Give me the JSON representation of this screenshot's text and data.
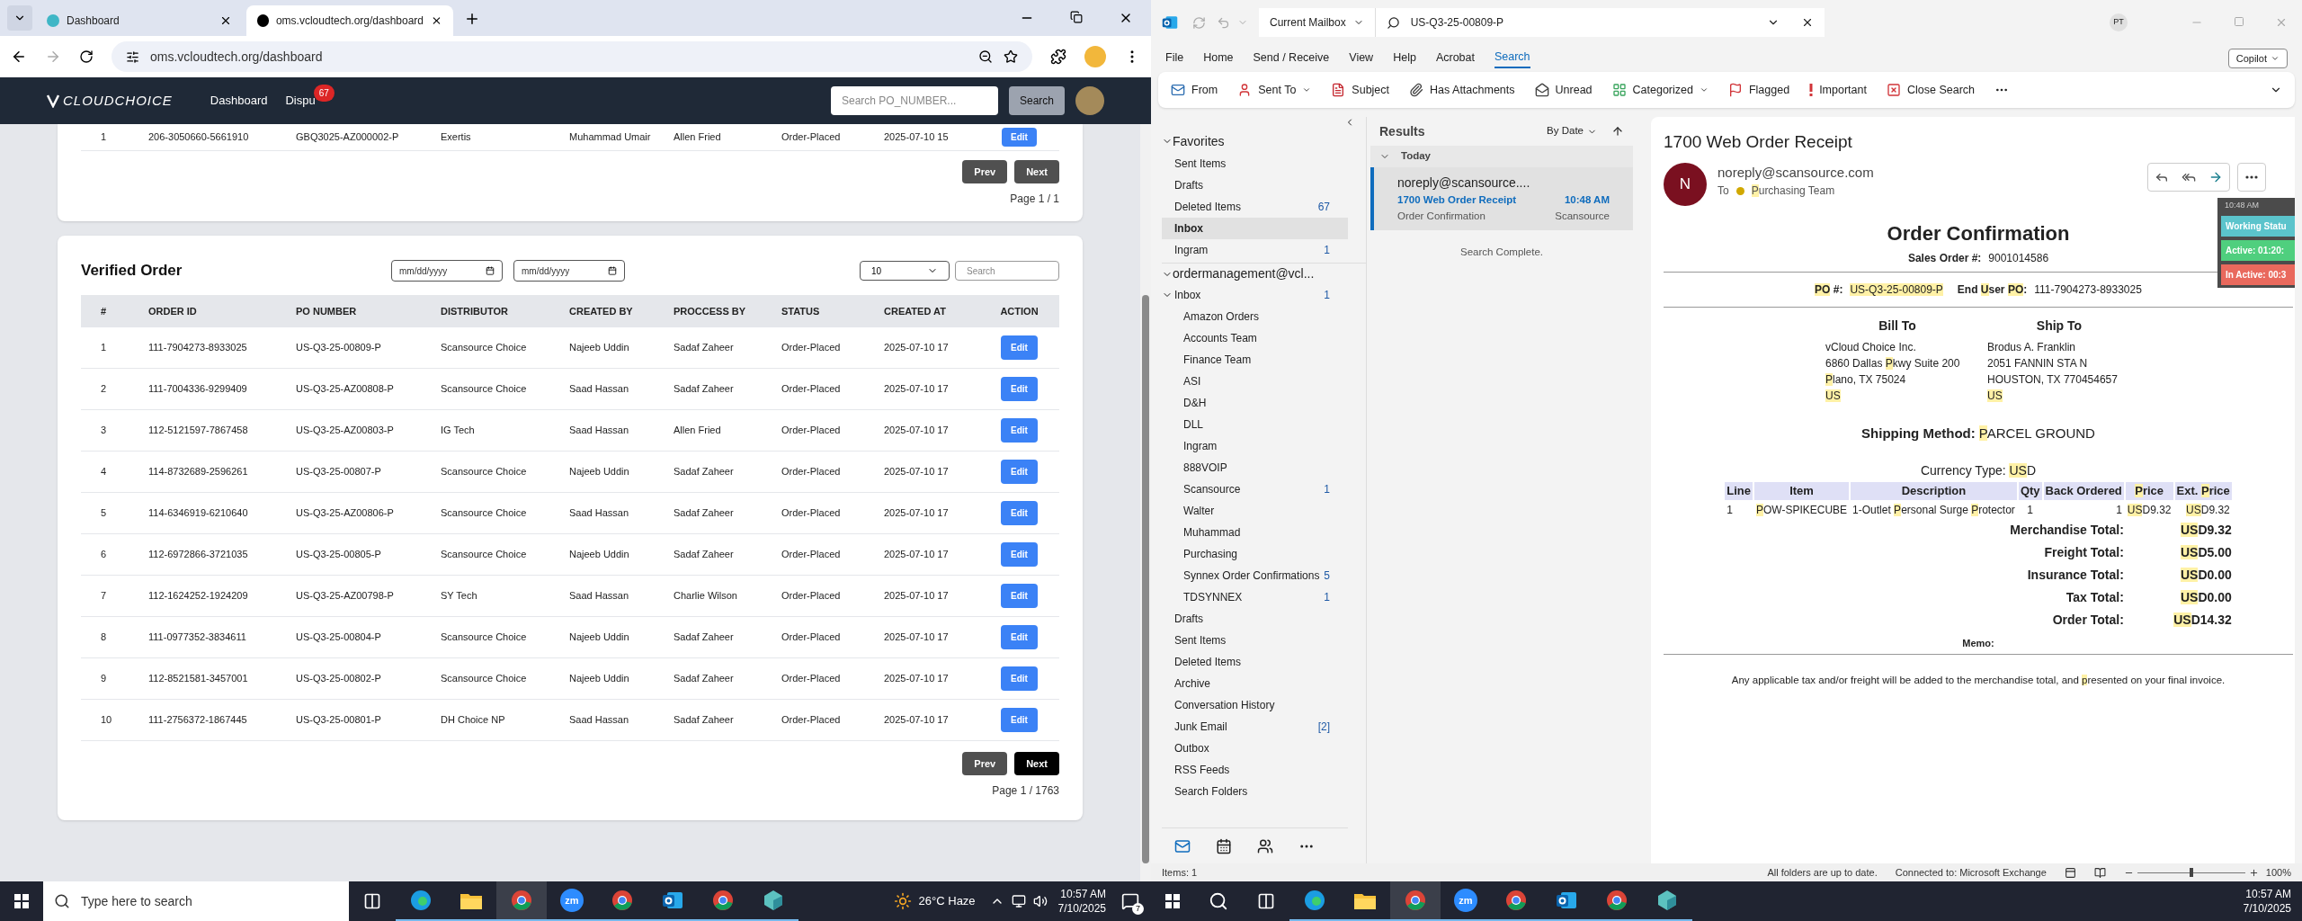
{
  "browser": {
    "tabs": [
      {
        "title": "Dashboard",
        "selected": false
      },
      {
        "title": "oms.vcloudtech.org/dashboard",
        "selected": true
      }
    ],
    "url": "oms.vcloudtech.org/dashboard",
    "app": {
      "logo": "CLOUDCHOICE",
      "nav": [
        {
          "label": "Dashboard"
        },
        {
          "label": "Dispu",
          "badge": "67"
        }
      ],
      "search_placeholder": "Search PO_NUMBER...",
      "search_button": "Search",
      "previous_table": {
        "rows": [
          {
            "cells": [
              "1",
              "206-3050660-5661910",
              "GBQ3025-AZ000002-P",
              "Exertis",
              "Muhammad Umair",
              "Allen Fried",
              "Order-Placed",
              "2025-07-10 15"
            ],
            "action": "Edit"
          }
        ],
        "prev": {
          "label": "Prev",
          "disabled": true
        },
        "next": {
          "label": "Next",
          "disabled": true
        },
        "page": "Page 1 / 1"
      },
      "verified": {
        "title": "Verified Order",
        "date_placeholders": [
          "mm/dd/yyyy",
          "mm/dd/yyyy"
        ],
        "page_size": "10",
        "search_placeholder": "Search",
        "columns": [
          "#",
          "ORDER ID",
          "PO NUMBER",
          "DISTRIBUTOR",
          "CREATED BY",
          "PROCCESS BY",
          "STATUS",
          "CREATED AT",
          "ACTION"
        ],
        "rows": [
          {
            "cells": [
              "1",
              "111-7904273-8933025",
              "US-Q3-25-00809-P",
              "Scansource Choice",
              "Najeeb Uddin",
              "Sadaf Zaheer",
              "Order-Placed",
              "2025-07-10 17"
            ],
            "action": "Edit"
          },
          {
            "cells": [
              "2",
              "111-7004336-9299409",
              "US-Q3-25-AZ00808-P",
              "Scansource Choice",
              "Saad Hassan",
              "Sadaf Zaheer",
              "Order-Placed",
              "2025-07-10 17"
            ],
            "action": "Edit"
          },
          {
            "cells": [
              "3",
              "112-5121597-7867458",
              "US-Q3-25-AZ00803-P",
              "IG Tech",
              "Saad Hassan",
              "Allen Fried",
              "Order-Placed",
              "2025-07-10 17"
            ],
            "action": "Edit"
          },
          {
            "cells": [
              "4",
              "114-8732689-2596261",
              "US-Q3-25-00807-P",
              "Scansource Choice",
              "Najeeb Uddin",
              "Sadaf Zaheer",
              "Order-Placed",
              "2025-07-10 17"
            ],
            "action": "Edit"
          },
          {
            "cells": [
              "5",
              "114-6346919-6210640",
              "US-Q3-25-AZ00806-P",
              "Scansource Choice",
              "Saad Hassan",
              "Sadaf Zaheer",
              "Order-Placed",
              "2025-07-10 17"
            ],
            "action": "Edit"
          },
          {
            "cells": [
              "6",
              "112-6972866-3721035",
              "US-Q3-25-00805-P",
              "Scansource Choice",
              "Najeeb Uddin",
              "Sadaf Zaheer",
              "Order-Placed",
              "2025-07-10 17"
            ],
            "action": "Edit"
          },
          {
            "cells": [
              "7",
              "112-1624252-1924209",
              "US-Q3-25-AZ00798-P",
              "SY Tech",
              "Saad Hassan",
              "Charlie Wilson",
              "Order-Placed",
              "2025-07-10 17"
            ],
            "action": "Edit"
          },
          {
            "cells": [
              "8",
              "111-0977352-3834611",
              "US-Q3-25-00804-P",
              "Scansource Choice",
              "Najeeb Uddin",
              "Sadaf Zaheer",
              "Order-Placed",
              "2025-07-10 17"
            ],
            "action": "Edit"
          },
          {
            "cells": [
              "9",
              "112-8521581-3457001",
              "US-Q3-25-00802-P",
              "Scansource Choice",
              "Najeeb Uddin",
              "Sadaf Zaheer",
              "Order-Placed",
              "2025-07-10 17"
            ],
            "action": "Edit"
          },
          {
            "cells": [
              "10",
              "111-2756372-1867445",
              "US-Q3-25-00801-P",
              "DH Choice NP",
              "Saad Hassan",
              "Sadaf Zaheer",
              "Order-Placed",
              "2025-07-10 17"
            ],
            "action": "Edit"
          }
        ],
        "prev": {
          "label": "Prev",
          "disabled": true
        },
        "next": {
          "label": "Next",
          "disabled": false
        },
        "page": "Page 1 / 1763"
      }
    }
  },
  "outlook": {
    "scope": "Current Mailbox",
    "search": "US-Q3-25-00809-P",
    "user": "PT",
    "copilot": "Copilot",
    "menu": [
      {
        "label": "File",
        "selected": false
      },
      {
        "label": "Home",
        "selected": false
      },
      {
        "label": "Send / Receive",
        "selected": false
      },
      {
        "label": "View",
        "selected": false
      },
      {
        "label": "Help",
        "selected": false
      },
      {
        "label": "Acrobat",
        "selected": false
      },
      {
        "label": "Search",
        "selected": true
      }
    ],
    "ribbon": [
      {
        "label": "From",
        "kind": "from"
      },
      {
        "label": "Sent To",
        "kind": "sent",
        "dropdown": true
      },
      {
        "label": "Subject",
        "kind": "subject"
      },
      {
        "label": "Has Attachments",
        "kind": "attachment"
      },
      {
        "label": "Unread",
        "kind": "unread"
      },
      {
        "label": "Categorized",
        "kind": "category",
        "dropdown": true
      },
      {
        "label": "Flagged",
        "kind": "flag"
      },
      {
        "label": "Important",
        "kind": "important"
      },
      {
        "label": "Close Search",
        "kind": "close"
      }
    ],
    "favorites": {
      "title": "Favorites",
      "expanded": true,
      "items": [
        {
          "label": "Sent Items",
          "selected": false
        },
        {
          "label": "Drafts",
          "selected": false
        },
        {
          "label": "Deleted Items",
          "count": "67",
          "selected": false
        },
        {
          "label": "Inbox",
          "selected": true
        },
        {
          "label": "Ingram",
          "count": "1",
          "selected": false
        }
      ]
    },
    "account": {
      "title": "ordermanagement@vcl...",
      "expanded": true,
      "folders": [
        {
          "label": "Inbox",
          "count": "1",
          "expanded": true,
          "children": [
            {
              "label": "Amazon Orders"
            },
            {
              "label": "Accounts Team"
            },
            {
              "label": "Finance Team"
            },
            {
              "label": "ASI"
            },
            {
              "label": "D&H"
            },
            {
              "label": "DLL"
            },
            {
              "label": "Ingram"
            },
            {
              "label": "888VOIP"
            },
            {
              "label": "Scansource",
              "count": "1"
            },
            {
              "label": "Walter"
            },
            {
              "label": "Muhammad"
            },
            {
              "label": "Purchasing"
            },
            {
              "label": "Synnex Order Confirmations",
              "count": "5"
            },
            {
              "label": "TDSYNNEX",
              "count": "1"
            }
          ]
        },
        {
          "label": "Drafts"
        },
        {
          "label": "Sent Items"
        },
        {
          "label": "Deleted Items"
        },
        {
          "label": "Archive"
        },
        {
          "label": "Conversation History"
        },
        {
          "label": "Junk Email",
          "count": "[2]"
        },
        {
          "label": "Outbox"
        },
        {
          "label": "RSS Feeds"
        },
        {
          "label": "Search Folders"
        }
      ]
    },
    "results": {
      "title": "Results",
      "sort": "By Date",
      "group": "Today",
      "messages": [
        {
          "from": "noreply@scansource....",
          "subject": "1700 Web Order Receipt",
          "time": "10:48 AM",
          "preview": "Order Confirmation",
          "folder": "Scansource",
          "selected": true
        }
      ],
      "status": "Search Complete."
    },
    "email": {
      "subject": "1700 Web Order Receipt",
      "avatar": "N",
      "sender": "noreply@scansource.com",
      "to_label": "To",
      "to": [
        {
          "text": "P",
          "hl": true
        },
        {
          "text": "urchasing Team",
          "hl": false
        }
      ],
      "title": "Order Confirmation",
      "sales_label": "Sales Order #:",
      "sales_value": "9001014586",
      "po_label": [
        {
          "text": "PO",
          "hl": true
        },
        {
          "text": " #:",
          "hl": false
        }
      ],
      "po_value": [
        {
          "text": "US-Q3-25-00809-P",
          "hl": true
        }
      ],
      "end_user_label": [
        {
          "text": "End ",
          "hl": false
        },
        {
          "text": "U",
          "hl": true
        },
        {
          "text": "ser ",
          "hl": false
        },
        {
          "text": "PO",
          "hl": true
        },
        {
          "text": ":",
          "hl": false
        }
      ],
      "end_user_value": "111-7904273-8933025",
      "bill_to": {
        "title": "Bill To",
        "lines": [
          [
            {
              "text": "vCloud Choice Inc.",
              "hl": false
            }
          ],
          [
            {
              "text": "6860 Dallas ",
              "hl": false
            },
            {
              "text": "P",
              "hl": true
            },
            {
              "text": "kwy Suite 200",
              "hl": false
            }
          ],
          [
            {
              "text": "P",
              "hl": true
            },
            {
              "text": "lano, TX 75024",
              "hl": false
            }
          ],
          [
            {
              "text": "US",
              "hl": true
            }
          ]
        ]
      },
      "ship_to": {
        "title": "Ship To",
        "lines": [
          [
            {
              "text": "Brodus A. Franklin",
              "hl": false
            }
          ],
          [
            {
              "text": "2051 FANNIN STA N",
              "hl": false
            }
          ],
          [
            {
              "text": "HOUSTON, TX 770454657",
              "hl": false
            }
          ],
          [
            {
              "text": "US",
              "hl": true
            }
          ]
        ]
      },
      "shipping_label": "Shipping Method:",
      "shipping_value": [
        {
          "text": "P",
          "hl": true
        },
        {
          "text": "ARCEL GROUND",
          "hl": false
        }
      ],
      "currency": [
        {
          "text": "Currency Type: ",
          "hl": false
        },
        {
          "text": "US",
          "hl": true
        },
        {
          "text": "D",
          "hl": false
        }
      ],
      "columns": [
        [
          {
            "text": "Line",
            "hl": false
          }
        ],
        [
          {
            "text": "Item",
            "hl": false
          }
        ],
        [
          {
            "text": "Description",
            "hl": false
          }
        ],
        [
          {
            "text": "Qty",
            "hl": false
          }
        ],
        [
          {
            "text": "Back Ordered",
            "hl": false
          }
        ],
        [
          {
            "text": "P",
            "hl": true
          },
          {
            "text": "rice",
            "hl": false
          }
        ],
        [
          {
            "text": "Ext. ",
            "hl": false
          },
          {
            "text": "P",
            "hl": true
          },
          {
            "text": "rice",
            "hl": false
          }
        ]
      ],
      "lines": [
        [
          [
            {
              "text": "1",
              "hl": false
            }
          ],
          [
            {
              "text": "P",
              "hl": true
            },
            {
              "text": "OW-SPIKECUBE",
              "hl": false
            }
          ],
          [
            {
              "text": "1-Outlet ",
              "hl": false
            },
            {
              "text": "P",
              "hl": true
            },
            {
              "text": "ersonal Surge ",
              "hl": false
            },
            {
              "text": "P",
              "hl": true
            },
            {
              "text": "rotector",
              "hl": false
            }
          ],
          [
            {
              "text": "1",
              "hl": false
            }
          ],
          [
            {
              "text": "1",
              "hl": false
            }
          ],
          [
            {
              "text": "US",
              "hl": true
            },
            {
              "text": "D9.32",
              "hl": false
            }
          ],
          [
            {
              "text": "US",
              "hl": true
            },
            {
              "text": "D9.32",
              "hl": false
            }
          ]
        ]
      ],
      "totals": [
        {
          "label": "Merchandise Total:",
          "value": [
            {
              "text": "US",
              "hl": true
            },
            {
              "text": "D9.32",
              "hl": false
            }
          ]
        },
        {
          "label": "Freight Total:",
          "value": [
            {
              "text": "US",
              "hl": true
            },
            {
              "text": "D5.00",
              "hl": false
            }
          ]
        },
        {
          "label": "Insurance Total:",
          "value": [
            {
              "text": "US",
              "hl": true
            },
            {
              "text": "D0.00",
              "hl": false
            }
          ]
        },
        {
          "label": "Tax Total:",
          "value": [
            {
              "text": "US",
              "hl": true
            },
            {
              "text": "D0.00",
              "hl": false
            }
          ]
        },
        {
          "label": "Order Total:",
          "value": [
            {
              "text": "US",
              "hl": true
            },
            {
              "text": "D14.32",
              "hl": false
            }
          ]
        }
      ],
      "memo": "Memo:",
      "footer": [
        {
          "text": "Any applicable tax and/or freight will be added to the merchandise total, and ",
          "hl": false
        },
        {
          "text": "p",
          "hl": true
        },
        {
          "text": "resented on your final invoice.",
          "hl": false
        }
      ]
    },
    "overlay": {
      "time": "10:48 AM",
      "statuses": [
        {
          "label": "Working Statu",
          "color": "#5bc4cc"
        },
        {
          "label": "Active: 01:20:",
          "color": "#4fcf7e"
        },
        {
          "label": "In Active: 00:3",
          "color": "#e9695d"
        }
      ]
    },
    "status_bar": {
      "items": "Items: 1",
      "sync": "All folders are up to date.",
      "connection": "Connected to: Microsoft Exchange",
      "zoom": "100%",
      "level": 0.5
    }
  },
  "taskbar_left": {
    "search": "Type here to search",
    "apps": [
      {
        "kind": "edge",
        "selected": false
      },
      {
        "kind": "folder",
        "selected": false
      },
      {
        "kind": "chrome",
        "selected": true
      },
      {
        "kind": "zoom",
        "label": "zm",
        "selected": false
      },
      {
        "kind": "chrome",
        "selected": false
      },
      {
        "kind": "outlook",
        "selected": false
      },
      {
        "kind": "chrome",
        "selected": false
      },
      {
        "kind": "app",
        "selected": false
      }
    ],
    "weather": "26°C  Haze",
    "time": "10:57 AM",
    "date": "7/10/2025",
    "notifications": "7"
  },
  "taskbar_right": {
    "apps": [
      {
        "kind": "edge",
        "selected": false
      },
      {
        "kind": "folder",
        "selected": false
      },
      {
        "kind": "chrome",
        "selected": true
      },
      {
        "kind": "zoom",
        "label": "zm",
        "selected": false
      },
      {
        "kind": "chrome",
        "selected": false
      },
      {
        "kind": "outlook",
        "selected": false
      },
      {
        "kind": "chrome",
        "selected": false
      },
      {
        "kind": "app",
        "selected": false
      }
    ],
    "time": "10:57 AM",
    "date": "7/10/2025"
  }
}
